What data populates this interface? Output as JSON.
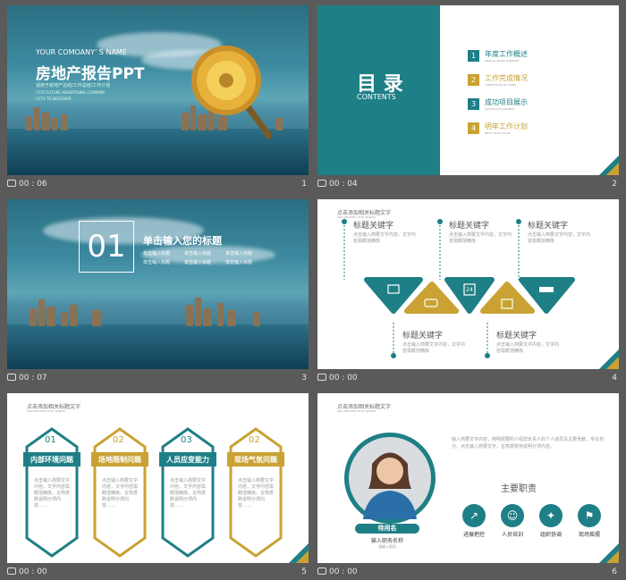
{
  "slides": [
    {
      "time": "00 : 06",
      "num": "1",
      "company": "YOUR COMOANY' S NAME",
      "title": "房地产报告PPT",
      "sub1": "适用于房地产总结/工作总结/工作计划",
      "sub2": "CCTV FUTURE ADVERTISING COMPANY",
      "sub3": "CCTV TO DISCOVER"
    },
    {
      "time": "00 : 04",
      "num": "2",
      "title": "目 录",
      "subtitle": "CONTENTS",
      "items": [
        {
          "n": "1",
          "t": "年度工作概述",
          "s": "ANNUAL WORK SUMMARY"
        },
        {
          "n": "2",
          "t": "工作完成情况",
          "s": "COMPLETION OF WORK"
        },
        {
          "n": "3",
          "t": "成功项目展示",
          "s": "SUCCESSFUL PROJECT"
        },
        {
          "n": "4",
          "t": "明年工作计划",
          "s": "NEXT YEAR'S PLAN"
        }
      ]
    },
    {
      "time": "00 : 07",
      "num": "3",
      "big": "01",
      "title": "单击输入您的标题",
      "points": [
        "单击输入标题",
        "单击输入标题",
        "单击输入标题",
        "单击输入标题",
        "单击输入标题",
        "单击输入标题"
      ]
    },
    {
      "time": "00 : 00",
      "num": "4",
      "head": "点击添加相关标题文字",
      "headsub": "ADD RELATED TITLE WORDS",
      "kw": "标题关键字",
      "desc": "点击输入简要文字内容，文字内容需概括精炼",
      "dates": [
        "24"
      ]
    },
    {
      "time": "00 : 00",
      "num": "5",
      "head": "点击添加相关标题文字",
      "headsub": "ADD RELATED TITLE WORDS",
      "cards": [
        {
          "n": "01",
          "t": "内部环境问题"
        },
        {
          "n": "02",
          "t": "场地限制问题"
        },
        {
          "n": "03",
          "t": "人员应变能力"
        },
        {
          "n": "02",
          "t": "现场气氛问题"
        }
      ],
      "cardtext": "点击输入简要文字内容，文字内容需概括精炼，言简意赅说明分项内容……"
    },
    {
      "time": "00 : 00",
      "num": "6",
      "head": "点击添加相关标题文字",
      "headsub": "ADD RELATED TITLE WORDS",
      "name": "待用名",
      "role": "输入职务名称",
      "roleen": "请输入职务",
      "para": "输入简要文字内容，简明扼要的介绍您负责人的个人成员及主要贡献，专业划分。点击输入简要文字，言简意赅地说明分项内容。",
      "duty": "主要职责",
      "duties": [
        "进展把控",
        "人员培训",
        "组织协调",
        "现场摇摆"
      ]
    }
  ]
}
